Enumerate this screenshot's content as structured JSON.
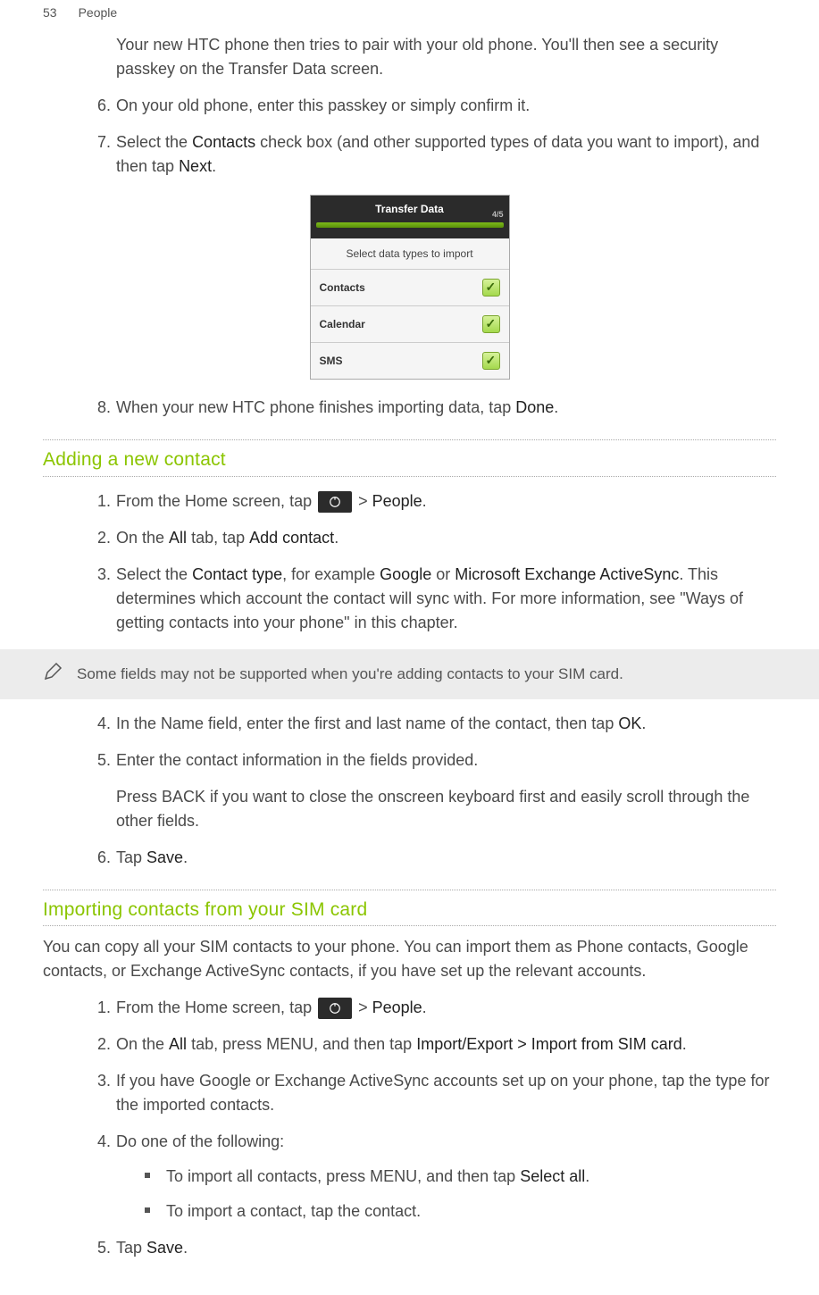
{
  "header": {
    "page_num": "53",
    "section": "People"
  },
  "pre_list": {
    "para": "Your new HTC phone then tries to pair with your old phone. You'll then see a security passkey on the Transfer Data screen."
  },
  "steps_a": {
    "s6_num": "6.",
    "s6_text": "On your old phone, enter this passkey or simply confirm it.",
    "s7_num": "7.",
    "s7_a": "Select the ",
    "s7_b_strong": "Contacts",
    "s7_c": " check box (and other supported types of data you want to import), and then tap ",
    "s7_d_strong": "Next",
    "s7_e": ".",
    "s8_num": "8.",
    "s8_a": "When your new HTC phone finishes importing data, tap ",
    "s8_b_strong": "Done",
    "s8_c": "."
  },
  "screenshot": {
    "title": "Transfer Data",
    "step": "4/5",
    "subtitle": "Select data types to import",
    "row1": "Contacts",
    "row2": "Calendar",
    "row3": "SMS"
  },
  "sec1": {
    "title": "Adding a new contact",
    "s1_num": "1.",
    "s1_a": "From the Home screen, tap ",
    "s1_b": " > ",
    "s1_c_strong": "People",
    "s1_d": ".",
    "s2_num": "2.",
    "s2_a": "On the ",
    "s2_b_strong": "All",
    "s2_c": " tab, tap ",
    "s2_d_strong": "Add contact",
    "s2_e": ".",
    "s3_num": "3.",
    "s3_a": "Select the ",
    "s3_b_strong": "Contact type",
    "s3_c": ", for example ",
    "s3_d_strong": "Google",
    "s3_e": " or ",
    "s3_f_strong": "Microsoft Exchange ActiveSync",
    "s3_g": ". This determines which account the contact will sync with. For more information, see \"Ways of getting contacts into your phone\" in this chapter.",
    "note": "Some fields may not be supported when you're adding contacts to your SIM card.",
    "s4_num": "4.",
    "s4_a": "In the Name field, enter the first and last name of the contact, then tap ",
    "s4_b_strong": "OK",
    "s4_c": ".",
    "s5_num": "5.",
    "s5_a": "Enter the contact information in the fields provided.",
    "s5_sub": "Press BACK if you want to close the onscreen keyboard first and easily scroll through the other fields.",
    "s6_num": "6.",
    "s6_a": "Tap ",
    "s6_b_strong": "Save",
    "s6_c": "."
  },
  "sec2": {
    "title": "Importing contacts from your SIM card",
    "intro": "You can copy all your SIM contacts to your phone. You can import them as Phone contacts, Google contacts, or Exchange ActiveSync contacts, if you have set up the relevant accounts.",
    "s1_num": "1.",
    "s1_a": "From the Home screen, tap ",
    "s1_b": " > ",
    "s1_c_strong": "People",
    "s1_d": ".",
    "s2_num": "2.",
    "s2_a": "On the ",
    "s2_b_strong": "All",
    "s2_c": " tab, press MENU, and then tap ",
    "s2_d_strong": "Import/Export > Import from SIM card",
    "s2_e": ".",
    "s3_num": "3.",
    "s3_text": "If you have Google or Exchange ActiveSync accounts set up on your phone, tap the type for the imported contacts.",
    "s4_num": "4.",
    "s4_text": "Do one of the following:",
    "b1_a": "To import all contacts, press MENU, and then tap ",
    "b1_b_strong": "Select all",
    "b1_c": ".",
    "b2": "To import a contact, tap the contact.",
    "s5_num": "5.",
    "s5_a": "Tap ",
    "s5_b_strong": "Save",
    "s5_c": "."
  }
}
